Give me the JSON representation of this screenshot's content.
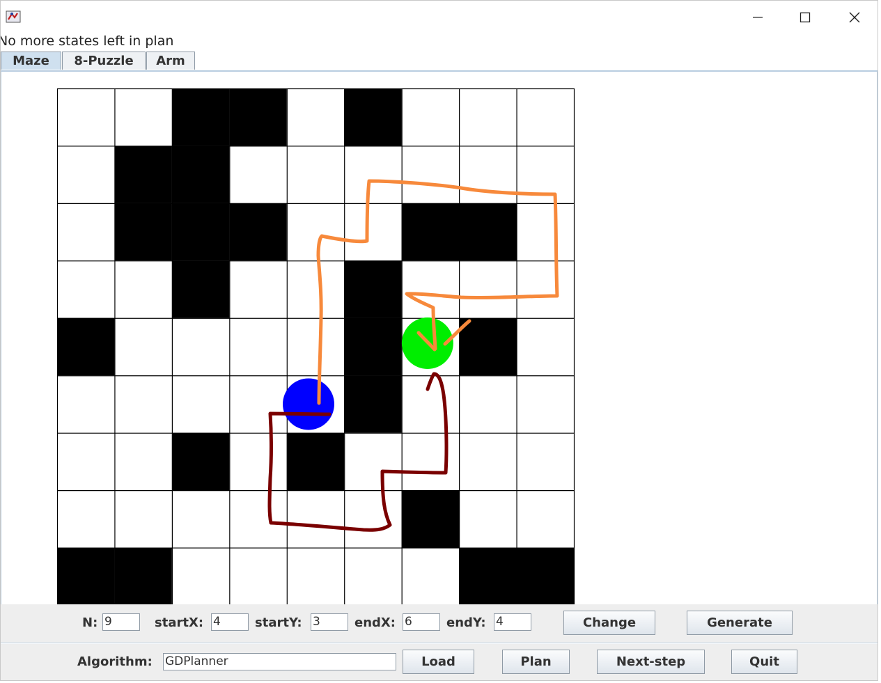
{
  "status_text": "No more states left in plan",
  "tabs": [
    {
      "label": "Maze",
      "active": true
    },
    {
      "label": "8-Puzzle",
      "active": false
    },
    {
      "label": "Arm",
      "active": false
    }
  ],
  "params": {
    "n_label": "N:",
    "n_value": "9",
    "startx_label": "startX:",
    "startx_value": "4",
    "starty_label": "startY:",
    "starty_value": "3",
    "endx_label": "endX:",
    "endx_value": "6",
    "endy_label": "endY:",
    "endy_value": "4",
    "change_label": "Change",
    "generate_label": "Generate"
  },
  "controls": {
    "algorithm_label": "Algorithm:",
    "algorithm_value": "GDPlanner",
    "load_label": "Load",
    "plan_label": "Plan",
    "next_step_label": "Next-step",
    "quit_label": "Quit"
  },
  "maze": {
    "size": 9,
    "walls": [
      [
        0,
        0,
        1,
        1,
        0,
        1,
        0,
        0,
        0
      ],
      [
        0,
        1,
        1,
        0,
        0,
        0,
        0,
        0,
        0
      ],
      [
        0,
        1,
        1,
        1,
        0,
        0,
        1,
        1,
        0
      ],
      [
        0,
        0,
        1,
        0,
        0,
        1,
        0,
        0,
        0
      ],
      [
        1,
        0,
        0,
        0,
        0,
        1,
        0,
        1,
        0
      ],
      [
        0,
        0,
        0,
        0,
        0,
        1,
        0,
        0,
        0
      ],
      [
        0,
        0,
        1,
        0,
        1,
        0,
        0,
        0,
        0
      ],
      [
        0,
        0,
        0,
        0,
        0,
        0,
        1,
        0,
        0
      ],
      [
        1,
        1,
        0,
        0,
        0,
        0,
        0,
        1,
        1
      ]
    ],
    "start": {
      "col": 4,
      "row": 5,
      "color": "#0000ff"
    },
    "goal": {
      "col": 6,
      "row": 4,
      "color": "#00ee00"
    },
    "wall_color": "#000000",
    "annotation_colors": {
      "orange": "#f7893b",
      "dark_red": "#7a0000"
    }
  }
}
